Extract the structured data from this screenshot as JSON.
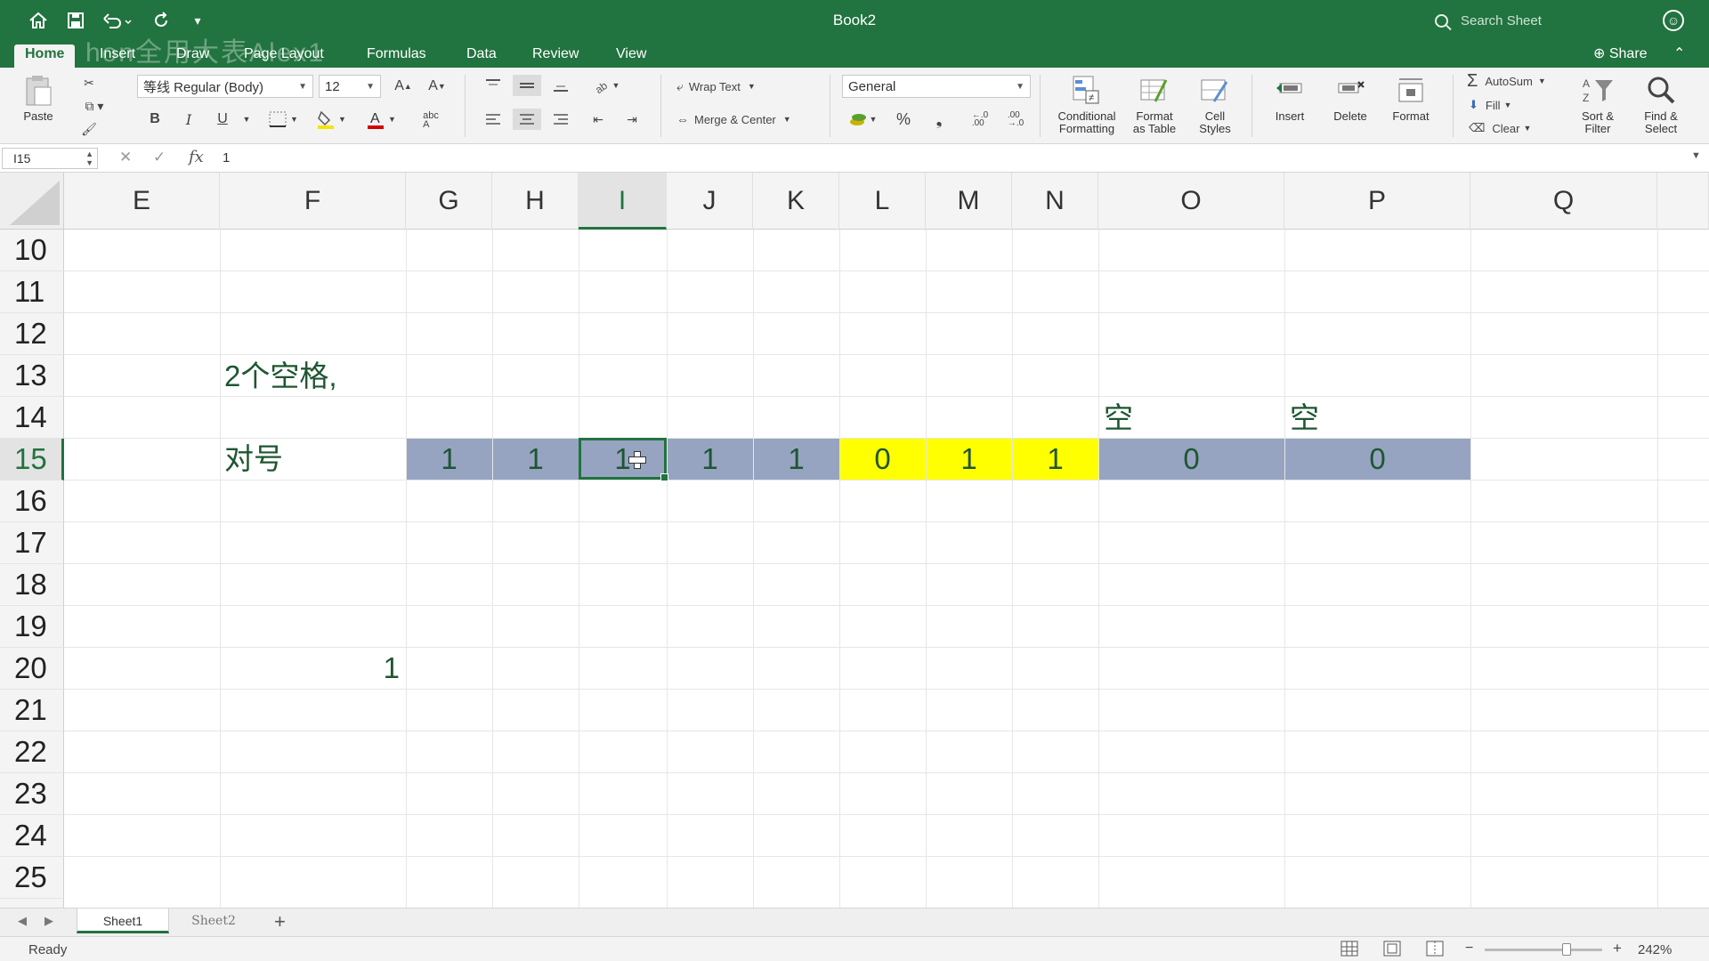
{
  "titlebar": {
    "title": "Book2",
    "search_placeholder": "Search Sheet"
  },
  "tabs": [
    "Home",
    "Insert",
    "Draw",
    "Page Layout",
    "Formulas",
    "Data",
    "Review",
    "View"
  ],
  "watermark": "hon全用大表Alex1",
  "share_label": "Share",
  "ribbon": {
    "paste": "Paste",
    "font_name": "等线 Regular (Body)",
    "font_size": "12",
    "bold": "B",
    "italic": "I",
    "underline": "U",
    "wrap_text": "Wrap Text",
    "merge_center": "Merge & Center",
    "number_format": "General",
    "percent": "%",
    "conditional_formatting": "Conditional\nFormatting",
    "format_as_table": "Format\nas Table",
    "cell_styles": "Cell\nStyles",
    "insert": "Insert",
    "delete": "Delete",
    "format": "Format",
    "autosum": "AutoSum",
    "fill": "Fill",
    "clear": "Clear",
    "sort_filter": "Sort &\nFilter",
    "find_select": "Find &\nSelect"
  },
  "formula_bar": {
    "name_box": "I15",
    "fx": "fx",
    "value": "1"
  },
  "columns": [
    {
      "label": "E"
    },
    {
      "label": "F"
    },
    {
      "label": "G"
    },
    {
      "label": "H"
    },
    {
      "label": "I",
      "selected": true
    },
    {
      "label": "J"
    },
    {
      "label": "K"
    },
    {
      "label": "L"
    },
    {
      "label": "M"
    },
    {
      "label": "N"
    },
    {
      "label": "O"
    },
    {
      "label": "P"
    },
    {
      "label": "Q"
    }
  ],
  "rows": [
    "10",
    "11",
    "12",
    "13",
    "14",
    "15",
    "16",
    "17",
    "18",
    "19",
    "20",
    "21",
    "22",
    "23",
    "24",
    "25"
  ],
  "selected_row": "15",
  "cells": {
    "f13": "2个空格,",
    "o14": "空",
    "p14": "空",
    "f15": "对号",
    "g15": "1",
    "h15": "1",
    "i15": "1",
    "j15": "1",
    "k15": "1",
    "l15": "0",
    "m15": "1",
    "n15": "1",
    "o15": "0",
    "p15": "0",
    "f20": "1"
  },
  "fill_colors": {
    "blue_gray": "#96a4c1",
    "yellow": "#ffff00",
    "accent": "#21733f"
  },
  "sheets": [
    "Sheet1",
    "Sheet2"
  ],
  "status": {
    "ready": "Ready",
    "zoom": "242%"
  }
}
